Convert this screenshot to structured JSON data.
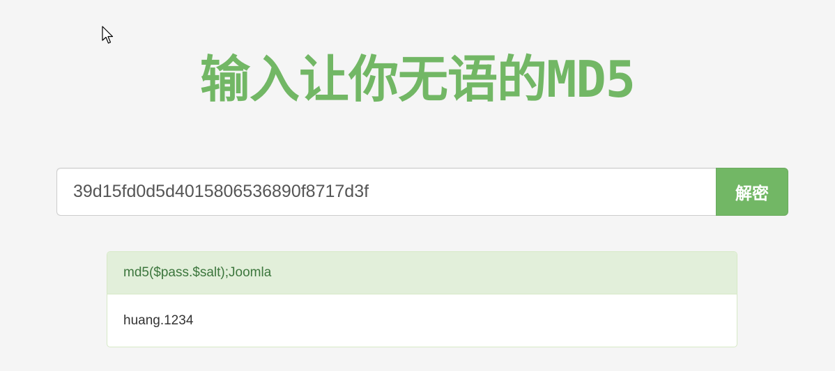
{
  "header": {
    "title": "输入让你无语的MD5"
  },
  "search": {
    "value": "39d15fd0d5d4015806536890f8717d3f",
    "button_label": "解密"
  },
  "result": {
    "type": "md5($pass.$salt);Joomla",
    "plaintext": "huang.1234"
  },
  "colors": {
    "brand_green": "#72b765",
    "panel_heading_bg": "#e2efda",
    "panel_heading_text": "#3c763d",
    "page_bg": "#f5f5f5"
  },
  "icons": {
    "cursor": "mouse-pointer-icon"
  }
}
